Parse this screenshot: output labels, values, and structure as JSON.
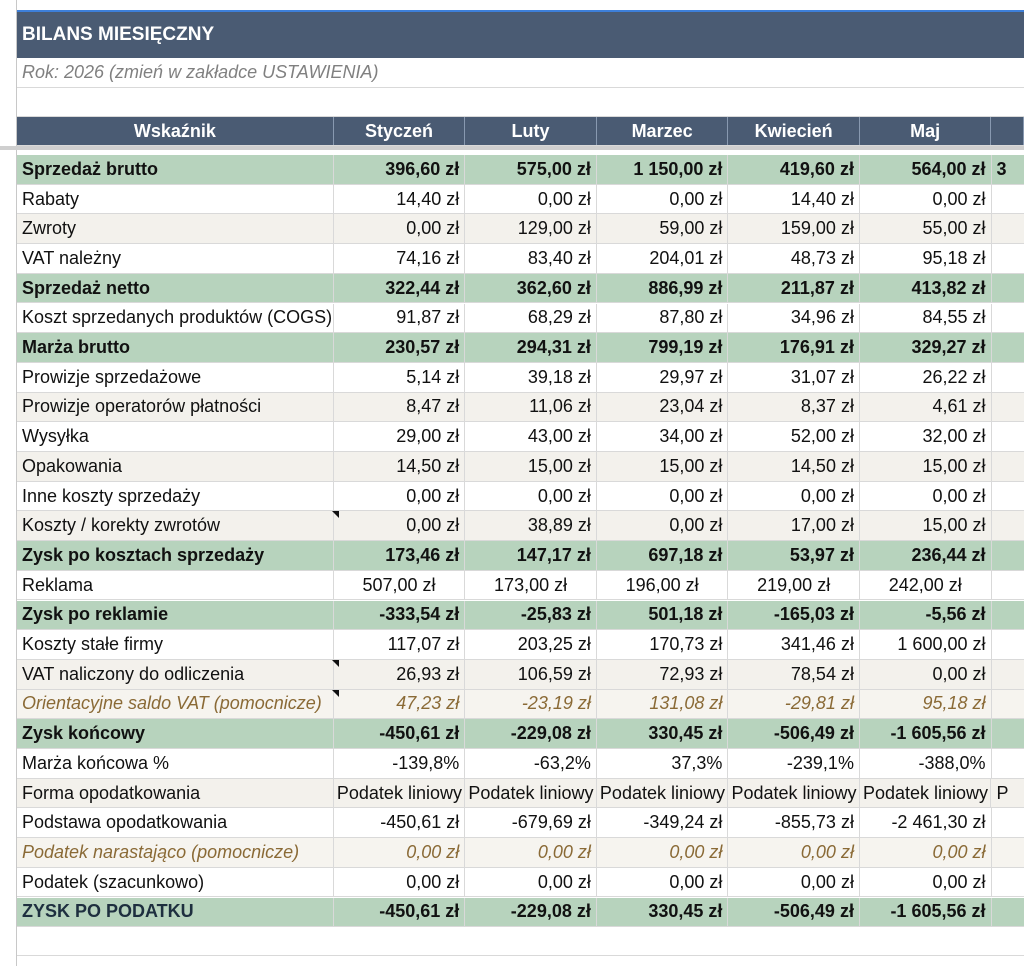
{
  "title": "BILANS MIESIĘCZNY",
  "year_note": "Rok: 2026 (zmień w zakładce USTAWIENIA)",
  "colors": {
    "header_bg": "#4a5b73",
    "accent_border": "#3d7fd9",
    "green_row": "#b7d3bd",
    "beige_row": "#f3f1ec",
    "italic_text": "#8a6a36"
  },
  "headers": [
    "Wskaźnik",
    "Styczeń",
    "Luty",
    "Marzec",
    "Kwiecień",
    "Maj"
  ],
  "rows": [
    {
      "style": "green",
      "label": "Sprzedaż brutto",
      "values": [
        "396,60 zł",
        "575,00 zł",
        "1 150,00 zł",
        "419,60 zł",
        "564,00 zł"
      ],
      "last": "3"
    },
    {
      "style": "white",
      "label": "Rabaty",
      "values": [
        "14,40 zł",
        "0,00 zł",
        "0,00 zł",
        "14,40 zł",
        "0,00 zł"
      ],
      "last": ""
    },
    {
      "style": "beige",
      "label": "Zwroty",
      "values": [
        "0,00 zł",
        "129,00 zł",
        "59,00 zł",
        "159,00 zł",
        "55,00 zł"
      ],
      "last": ""
    },
    {
      "style": "white",
      "label": "VAT należny",
      "values": [
        "74,16 zł",
        "83,40 zł",
        "204,01 zł",
        "48,73 zł",
        "95,18 zł"
      ],
      "last": ""
    },
    {
      "style": "green",
      "label": "Sprzedaż netto",
      "values": [
        "322,44 zł",
        "362,60 zł",
        "886,99 zł",
        "211,87 zł",
        "413,82 zł"
      ],
      "last": ""
    },
    {
      "style": "white",
      "label": "Koszt sprzedanych produktów (COGS)",
      "values": [
        "91,87 zł",
        "68,29 zł",
        "87,80 zł",
        "34,96 zł",
        "84,55 zł"
      ],
      "last": ""
    },
    {
      "style": "green",
      "label": "Marża brutto",
      "values": [
        "230,57 zł",
        "294,31 zł",
        "799,19 zł",
        "176,91 zł",
        "329,27 zł"
      ],
      "last": ""
    },
    {
      "style": "white",
      "label": "Prowizje sprzedażowe",
      "values": [
        "5,14 zł",
        "39,18 zł",
        "29,97 zł",
        "31,07 zł",
        "26,22 zł"
      ],
      "last": ""
    },
    {
      "style": "beige",
      "label": "Prowizje operatorów płatności",
      "values": [
        "8,47 zł",
        "11,06 zł",
        "23,04 zł",
        "8,37 zł",
        "4,61 zł"
      ],
      "last": ""
    },
    {
      "style": "white",
      "label": "Wysyłka",
      "values": [
        "29,00 zł",
        "43,00 zł",
        "34,00 zł",
        "52,00 zł",
        "32,00 zł"
      ],
      "last": ""
    },
    {
      "style": "beige",
      "label": "Opakowania",
      "values": [
        "14,50 zł",
        "15,00 zł",
        "15,00 zł",
        "14,50 zł",
        "15,00 zł"
      ],
      "last": ""
    },
    {
      "style": "white",
      "label": "Inne koszty sprzedaży",
      "values": [
        "0,00 zł",
        "0,00 zł",
        "0,00 zł",
        "0,00 zł",
        "0,00 zł"
      ],
      "last": ""
    },
    {
      "style": "beige",
      "label": "Koszty / korekty zwrotów",
      "values": [
        "0,00 zł",
        "38,89 zł",
        "0,00 zł",
        "17,00 zł",
        "15,00 zł"
      ],
      "last": "",
      "note": true
    },
    {
      "style": "green",
      "label": "Zysk po kosztach sprzedaży",
      "values": [
        "173,46 zł",
        "147,17 zł",
        "697,18 zł",
        "53,97 zł",
        "236,44 zł"
      ],
      "last": ""
    },
    {
      "style": "white",
      "label": "Reklama",
      "values": [
        "507,00  zł",
        "173,00  zł",
        "196,00  zł",
        "219,00  zł",
        "242,00  zł"
      ],
      "last": "",
      "center": true
    },
    {
      "style": "green",
      "label": "Zysk po reklamie",
      "values": [
        "-333,54 zł",
        "-25,83 zł",
        "501,18 zł",
        "-165,03 zł",
        "-5,56 zł"
      ],
      "last": ""
    },
    {
      "style": "white",
      "label": "Koszty stałe firmy",
      "values": [
        "117,07 zł",
        "203,25 zł",
        "170,73 zł",
        "341,46 zł",
        "1 600,00 zł"
      ],
      "last": ""
    },
    {
      "style": "beige",
      "label": "VAT naliczony do odliczenia",
      "values": [
        "26,93 zł",
        "106,59 zł",
        "72,93 zł",
        "78,54 zł",
        "0,00 zł"
      ],
      "last": "",
      "note": true
    },
    {
      "style": "italic",
      "label": "Orientacyjne saldo VAT (pomocnicze)",
      "values": [
        "47,23 zł",
        "-23,19 zł",
        "131,08 zł",
        "-29,81 zł",
        "95,18 zł"
      ],
      "last": "",
      "note": true
    },
    {
      "style": "green",
      "label": "Zysk końcowy",
      "values": [
        "-450,61 zł",
        "-229,08 zł",
        "330,45 zł",
        "-506,49 zł",
        "-1 605,56 zł"
      ],
      "last": ""
    },
    {
      "style": "white",
      "label": "Marża końcowa %",
      "values": [
        "-139,8%",
        "-63,2%",
        "37,3%",
        "-239,1%",
        "-388,0%"
      ],
      "last": ""
    },
    {
      "style": "beige",
      "label": "Forma opodatkowania",
      "values": [
        "Podatek liniowy",
        "Podatek liniowy",
        "Podatek liniowy",
        "Podatek liniowy",
        "Podatek liniowy"
      ],
      "last": "P",
      "left": true
    },
    {
      "style": "white",
      "label": "Podstawa opodatkowania",
      "values": [
        "-450,61 zł",
        "-679,69 zł",
        "-349,24 zł",
        "-855,73 zł",
        "-2 461,30 zł"
      ],
      "last": ""
    },
    {
      "style": "italic",
      "label": "Podatek narastająco (pomocnicze)",
      "values": [
        "0,00 zł",
        "0,00 zł",
        "0,00 zł",
        "0,00 zł",
        "0,00 zł"
      ],
      "last": ""
    },
    {
      "style": "white",
      "label": "Podatek (szacunkowo)",
      "values": [
        "0,00 zł",
        "0,00 zł",
        "0,00 zł",
        "0,00 zł",
        "0,00 zł"
      ],
      "last": ""
    },
    {
      "style": "final",
      "label": "ZYSK PO PODATKU",
      "values": [
        "-450,61 zł",
        "-229,08 zł",
        "330,45 zł",
        "-506,49 zł",
        "-1 605,56 zł"
      ],
      "last": ""
    }
  ]
}
